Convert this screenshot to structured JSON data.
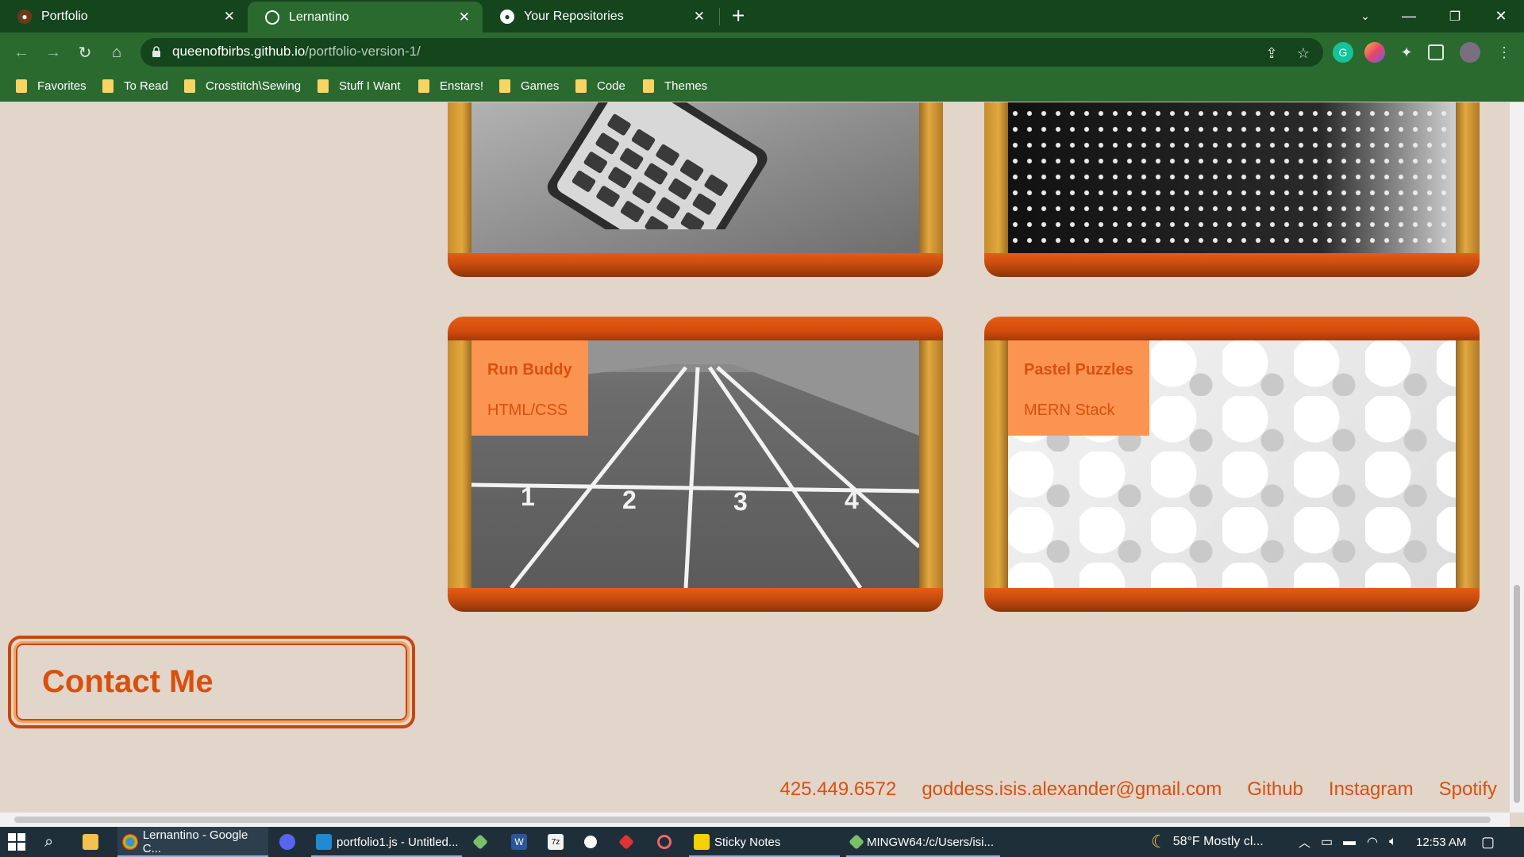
{
  "browser": {
    "tabs": [
      {
        "title": "Portfolio",
        "active": false
      },
      {
        "title": "Lernantino",
        "active": true
      },
      {
        "title": "Your Repositories",
        "active": false
      }
    ],
    "url_host": "queenofbirbs.github.io",
    "url_path": "/portfolio-version-1/",
    "bookmarks": [
      "Favorites",
      "To Read",
      "Crosstitch\\Sewing",
      "Stuff I Want",
      "Enstars!",
      "Games",
      "Code",
      "Themes"
    ]
  },
  "page": {
    "projects": [
      {
        "title": "Run Buddy",
        "tech": "HTML/CSS"
      },
      {
        "title": "Pastel Puzzles",
        "tech": "MERN Stack"
      }
    ],
    "contact_title": "Contact Me",
    "footer": {
      "phone": "425.449.6572",
      "email": "goddess.isis.alexander@gmail.com",
      "github": "Github",
      "instagram": "Instagram",
      "spotify": "Spotify"
    },
    "colors": {
      "background": "#e2d5c9",
      "accent": "#d8500f",
      "label_bg": "#fb9450",
      "frame_gold": "#e2a840"
    }
  },
  "taskbar": {
    "apps": [
      {
        "label": "Lernantino - Google C..."
      },
      {
        "label": "portfolio1.js - Untitled..."
      },
      {
        "label": "Sticky Notes"
      },
      {
        "label": "MINGW64:/c/Users/isi..."
      }
    ],
    "weather": "58°F  Mostly cl...",
    "time": "12:53 AM"
  }
}
